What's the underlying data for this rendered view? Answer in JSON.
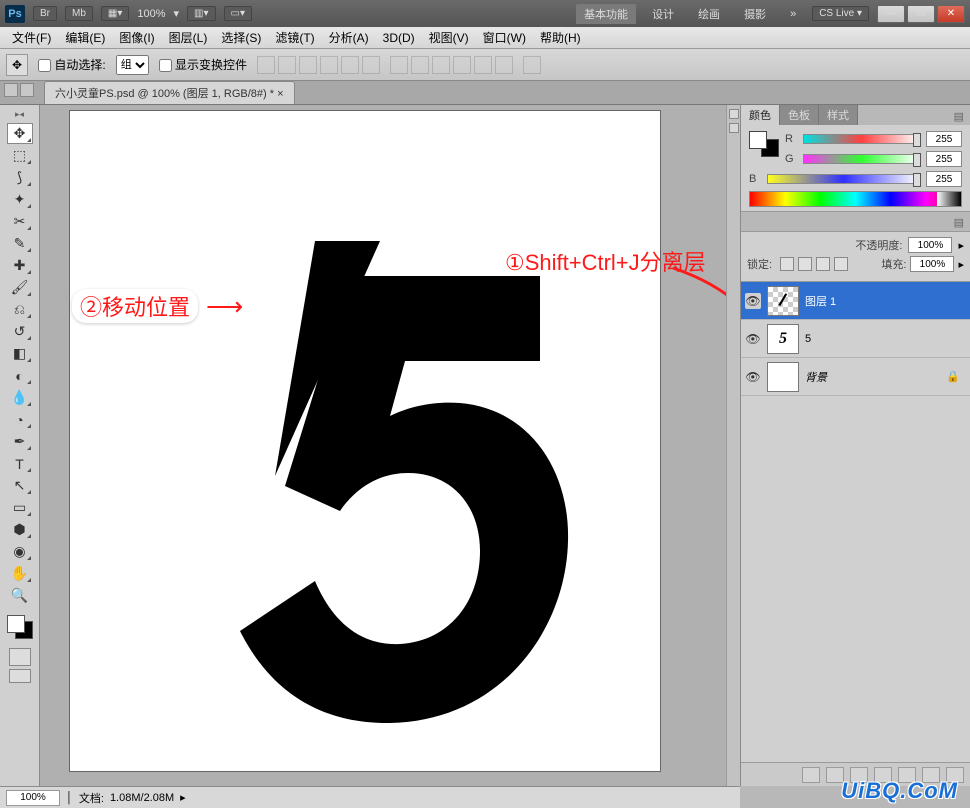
{
  "app": {
    "logo": "Ps",
    "br": "Br",
    "mb": "Mb",
    "zoom": "100%"
  },
  "workspaces": {
    "active": "基本功能",
    "items": [
      "设计",
      "绘画",
      "摄影"
    ],
    "more": "»",
    "cslive": "CS Live ▾"
  },
  "window_buttons": {
    "min": "—",
    "max": "▭",
    "close": "✕"
  },
  "menu": [
    "文件(F)",
    "编辑(E)",
    "图像(I)",
    "图层(L)",
    "选择(S)",
    "滤镜(T)",
    "分析(A)",
    "3D(D)",
    "视图(V)",
    "窗口(W)",
    "帮助(H)"
  ],
  "options": {
    "auto_select_label": "自动选择:",
    "auto_select_checked": false,
    "group_label": "组",
    "show_transform_label": "显示变换控件",
    "show_transform_checked": false
  },
  "doc_tab": "六小灵童PS.psd @ 100% (图层 1, RGB/8#) * ×",
  "annotations": {
    "a1": "①Shift+Ctrl+J分离层",
    "a2": "②移动位置",
    "arrow": "⟶"
  },
  "color_panel": {
    "tabs": [
      "颜色",
      "色板",
      "样式"
    ],
    "R_label": "R",
    "R_value": "255",
    "G_label": "G",
    "G_value": "255",
    "B_label": "B",
    "B_value": "255"
  },
  "layers_panel": {
    "opacity_label": "不透明度:",
    "opacity_value": "100%",
    "lock_label": "锁定:",
    "fill_label": "填充:",
    "fill_value": "100%",
    "items": [
      {
        "name": "图层 1",
        "selected": true,
        "thumb": "/",
        "checker": true
      },
      {
        "name": "5",
        "selected": false,
        "thumb": "5",
        "checker": false
      },
      {
        "name": "背景",
        "selected": false,
        "thumb": "",
        "checker": false,
        "locked": true,
        "italic": true
      }
    ]
  },
  "status": {
    "zoom": "100%",
    "doc_label": "文档:",
    "doc_info": "1.08M/2.08M"
  },
  "watermark": "UiBQ.CoM"
}
